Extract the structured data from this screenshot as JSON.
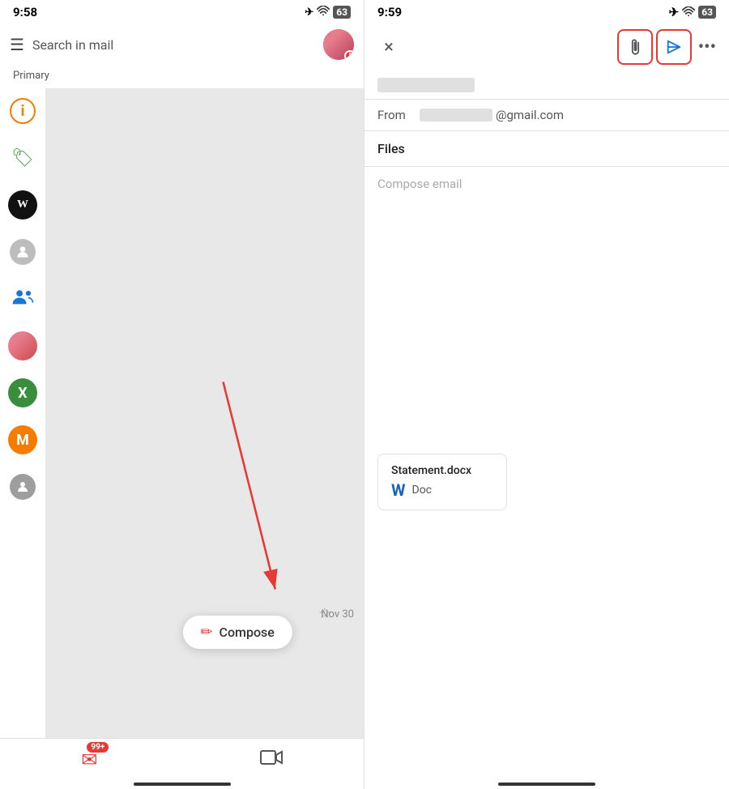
{
  "left": {
    "status_time": "9:58",
    "status_icons": "✈ ⊙ 63",
    "search_placeholder": "Search in mail",
    "primary_label": "Primary",
    "compose_label": "Compose",
    "email_date": "Nov 30",
    "bottom_nav": {
      "mail_badge": "99+",
      "mail_icon": "✉",
      "video_icon": "▭"
    },
    "sidebar_items": [
      {
        "id": "info",
        "label": "i"
      },
      {
        "id": "tag",
        "label": "tag"
      },
      {
        "id": "wp",
        "label": "W"
      },
      {
        "id": "person",
        "label": "person"
      },
      {
        "id": "people",
        "label": "people"
      },
      {
        "id": "avatar",
        "label": "avatar"
      },
      {
        "id": "x",
        "label": "X"
      },
      {
        "id": "m",
        "label": "M"
      },
      {
        "id": "person-gray",
        "label": "person-gray"
      }
    ]
  },
  "right": {
    "status_time": "9:59",
    "status_icons": "✈ ⊙ 63",
    "from_label": "From",
    "from_email_domain": "@gmail.com",
    "files_label": "Files",
    "compose_email_label": "Compose email",
    "attachment": {
      "name": "Statement.docx",
      "type": "Doc"
    },
    "buttons": {
      "close": "×",
      "attach": "🖇",
      "send": "▷",
      "more": "···"
    }
  }
}
